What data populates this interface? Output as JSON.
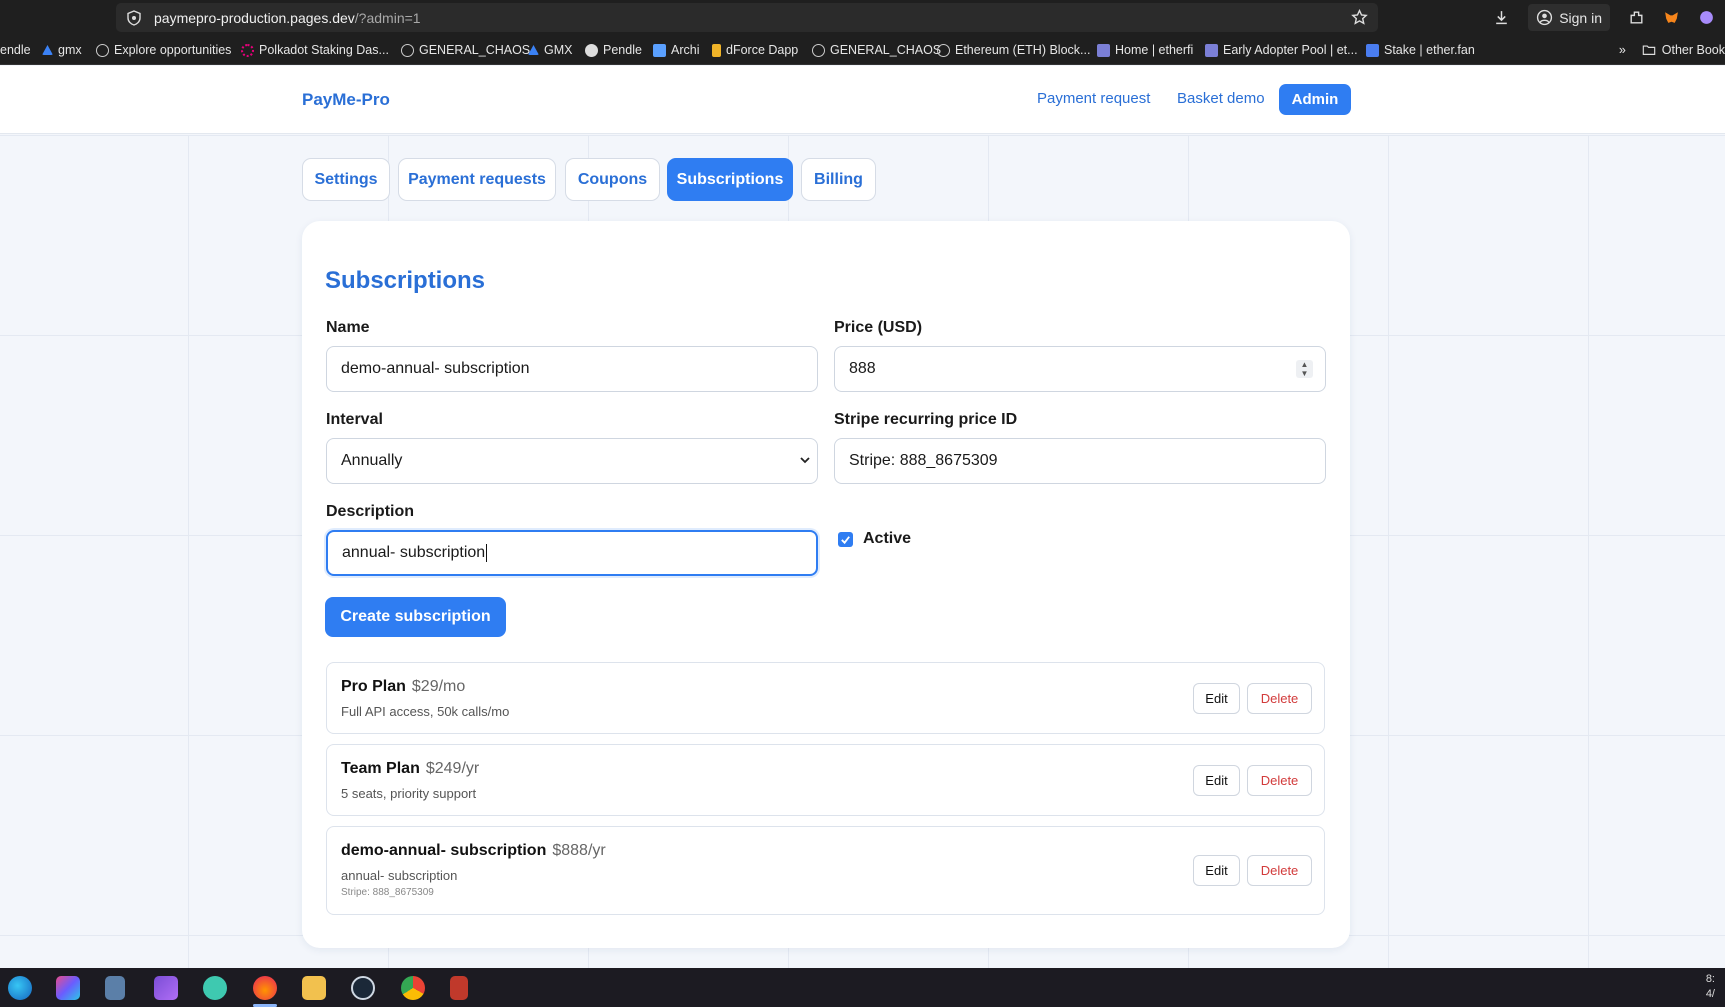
{
  "browser": {
    "url_host": "paymepro-production.pages.dev",
    "url_path": "/?admin=1",
    "sign_in": "Sign in",
    "bookmarks": [
      {
        "label": "endle",
        "color": "#3b82f6"
      },
      {
        "label": "gmx",
        "color": "#3b82f6"
      },
      {
        "label": "Explore opportunities",
        "color": "#cccccc"
      },
      {
        "label": "Polkadot Staking Das...",
        "color": "#e6007a"
      },
      {
        "label": "GENERAL_CHAOS",
        "color": "#cccccc"
      },
      {
        "label": "GMX",
        "color": "#3b82f6"
      },
      {
        "label": "Pendle",
        "color": "#dddddd"
      },
      {
        "label": "Archi",
        "color": "#5aa0ff"
      },
      {
        "label": "dForce Dapp",
        "color": "#f0b429"
      },
      {
        "label": "GENERAL_CHAOS",
        "color": "#cccccc"
      },
      {
        "label": "Ethereum (ETH) Block...",
        "color": "#cccccc"
      },
      {
        "label": "Home | etherfi",
        "color": "#7b7fd6"
      },
      {
        "label": "Early Adopter Pool | et...",
        "color": "#7b7fd6"
      },
      {
        "label": "Stake | ether.fan",
        "color": "#4a7df0"
      }
    ],
    "other_bookmarks": "Other Book"
  },
  "header": {
    "brand": "PayMe-Pro",
    "nav": {
      "payment_request": "Payment request",
      "basket_demo": "Basket demo",
      "admin": "Admin"
    }
  },
  "tabs": [
    {
      "label": "Settings",
      "active": false
    },
    {
      "label": "Payment requests",
      "active": false
    },
    {
      "label": "Coupons",
      "active": false
    },
    {
      "label": "Subscriptions",
      "active": true
    },
    {
      "label": "Billing",
      "active": false
    }
  ],
  "form": {
    "title": "Subscriptions",
    "name_label": "Name",
    "name_value": "demo-annual- subscription",
    "price_label": "Price (USD)",
    "price_value": "888",
    "interval_label": "Interval",
    "interval_value": "Annually",
    "stripe_label": "Stripe recurring price ID",
    "stripe_value": "Stripe: 888_8675309",
    "description_label": "Description",
    "description_value": "annual- subscription",
    "active_label": "Active",
    "active_checked": true,
    "submit_label": "Create subscription"
  },
  "subscriptions": [
    {
      "name": "Pro Plan",
      "price": "$29/mo",
      "description": "Full API access, 50k calls/mo",
      "stripe": "",
      "edit": "Edit",
      "delete": "Delete"
    },
    {
      "name": "Team Plan",
      "price": "$249/yr",
      "description": "5 seats, priority support",
      "stripe": "",
      "edit": "Edit",
      "delete": "Delete"
    },
    {
      "name": "demo-annual- subscription",
      "price": "$888/yr",
      "description": "annual- subscription",
      "stripe": "Stripe: 888_8675309",
      "edit": "Edit",
      "delete": "Delete"
    }
  ],
  "taskbar": {
    "apps": [
      "edge-icon",
      "m365-icon",
      "calculator-icon",
      "clipchamp-icon",
      "kodi-icon",
      "firefox-icon",
      "file-explorer-icon",
      "steam-icon",
      "chrome-icon",
      "app-icon"
    ],
    "clock_time": "8:",
    "clock_date": "4/"
  },
  "colors": {
    "accent": "#2f7df2",
    "link": "#2a6fd6",
    "danger": "#d23b3b"
  }
}
